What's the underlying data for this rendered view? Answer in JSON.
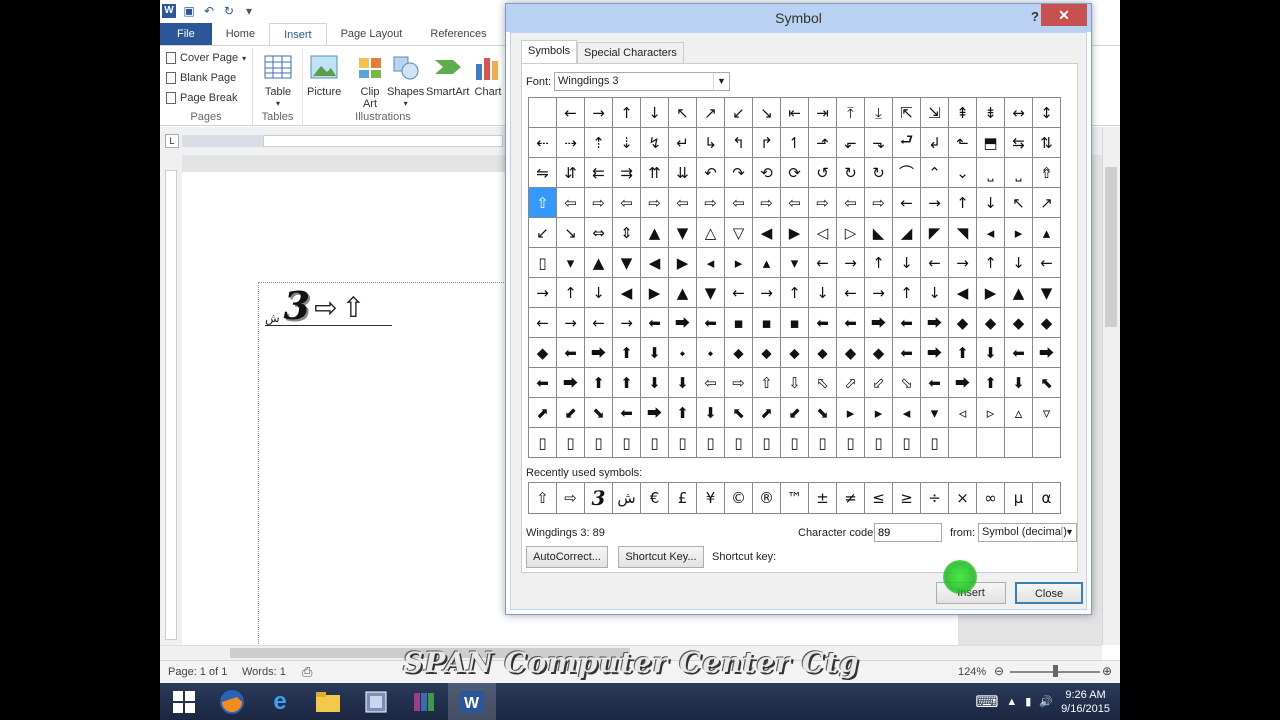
{
  "word": {
    "file_tab": "File",
    "tabs": [
      "Home",
      "Insert",
      "Page Layout",
      "References",
      "M"
    ],
    "pages_group": {
      "label": "Pages",
      "items": [
        "Cover Page",
        "Blank Page",
        "Page Break"
      ]
    },
    "tables_group": {
      "label": "Tables",
      "item": "Table"
    },
    "illustrations_group": {
      "label": "Illustrations",
      "items": [
        "Picture",
        "Clip Art",
        "Shapes",
        "SmartArt",
        "Chart"
      ]
    },
    "ruler_corner": "L",
    "status": {
      "page": "Page: 1 of 1",
      "words": "Words: 1",
      "zoom": "124%"
    },
    "doc_text_small": "ش"
  },
  "dialog": {
    "title": "Symbol",
    "help": "?",
    "close_x": "✕",
    "tabs": [
      "Symbols",
      "Special Characters"
    ],
    "font_label": "Font:",
    "font_value": "Wingdings 3",
    "grid": [
      [
        "",
        "←",
        "→",
        "↑",
        "↓",
        "↖",
        "↗",
        "↙",
        "↘",
        "⇤",
        "⇥",
        "⤒",
        "⤓",
        "⇱",
        "⇲",
        "⇞",
        "⇟",
        "↔",
        "↕"
      ],
      [
        "⇠",
        "⇢",
        "⇡",
        "⇣",
        "↯",
        "↵",
        "↳",
        "↰",
        "↱",
        "↿",
        "⬏",
        "⬐",
        "⬎",
        "⮐",
        "↲",
        "⬑",
        "⬒",
        "⇆",
        "⇅"
      ],
      [
        "⇋",
        "⇵",
        "⇇",
        "⇉",
        "⇈",
        "⇊",
        "↶",
        "↷",
        "⟲",
        "⟳",
        "↺",
        "↻",
        "↻",
        "⌒",
        "⌃",
        "⌄",
        "⎵",
        "⎵",
        "⇮"
      ],
      [
        "⇧",
        "⇦",
        "⇨",
        "⇦",
        "⇨",
        "⇦",
        "⇨",
        "⇦",
        "⇨",
        "⇦",
        "⇨",
        "⇦",
        "⇨",
        "←",
        "→",
        "↑",
        "↓",
        "↖",
        "↗"
      ],
      [
        "↙",
        "↘",
        "⇔",
        "⇕",
        "▲",
        "▼",
        "△",
        "▽",
        "◀",
        "▶",
        "◁",
        "▷",
        "◣",
        "◢",
        "◤",
        "◥",
        "◂",
        "▸",
        "▴"
      ],
      [
        "▯",
        "▾",
        "▲",
        "▼",
        "◀",
        "▶",
        "◂",
        "▸",
        "▴",
        "▾",
        "←",
        "→",
        "↑",
        "↓",
        "←",
        "→",
        "↑",
        "↓",
        "←"
      ],
      [
        "→",
        "↑",
        "↓",
        "◀",
        "▶",
        "▲",
        "▼",
        "←",
        "→",
        "↑",
        "↓",
        "←",
        "→",
        "↑",
        "↓",
        "◀",
        "▶",
        "▲",
        "▼"
      ],
      [
        "←",
        "→",
        "←",
        "→",
        "⬅",
        "⮕",
        "⬅",
        "▪",
        "▪",
        "▪",
        "⬅",
        "⬅",
        "⮕",
        "⬅",
        "⮕",
        "◆",
        "◆",
        "◆",
        "◆"
      ],
      [
        "◆",
        "⬅",
        "⮕",
        "⬆",
        "⬇",
        "⬩",
        "⬩",
        "⬥",
        "⬥",
        "⬥",
        "⬥",
        "◆",
        "◆",
        "⬅",
        "⮕",
        "⬆",
        "⬇",
        "⬅",
        "⮕"
      ],
      [
        "⬅",
        "⮕",
        "⬆",
        "⬆",
        "⬇",
        "⬇",
        "⇦",
        "⇨",
        "⇧",
        "⇩",
        "⬁",
        "⬀",
        "⬃",
        "⬂",
        "⬅",
        "⮕",
        "⬆",
        "⬇",
        "⬉"
      ],
      [
        "⬈",
        "⬋",
        "⬊",
        "⬅",
        "⮕",
        "⬆",
        "⬇",
        "⬉",
        "⬈",
        "⬋",
        "⬊",
        "▸",
        "▸",
        "◂",
        "▾",
        "◃",
        "▹",
        "▵",
        "▿"
      ],
      [
        "▯",
        "▯",
        "▯",
        "▯",
        "▯",
        "▯",
        "▯",
        "▯",
        "▯",
        "▯",
        "▯",
        "▯",
        "▯",
        "▯",
        "▯",
        "",
        "",
        "",
        ""
      ]
    ],
    "selected": {
      "row": 3,
      "col": 0
    },
    "recent_label": "Recently used symbols:",
    "recent": [
      "⇧",
      "⇨",
      "3",
      "ش",
      "€",
      "£",
      "¥",
      "©",
      "®",
      "™",
      "±",
      "≠",
      "≤",
      "≥",
      "÷",
      "×",
      "∞",
      "µ",
      "α"
    ],
    "char_name": "Wingdings 3: 89",
    "code_label": "Character code:",
    "code_value": "89",
    "from_label": "from:",
    "from_value": "Symbol (decimal)",
    "autocorrect": "AutoCorrect...",
    "shortcut_key_btn": "Shortcut Key...",
    "shortcut_key_label": "Shortcut key:",
    "insert": "Insert",
    "close": "Close"
  },
  "taskbar": {
    "time": "9:26 AM",
    "date": "9/16/2015"
  },
  "watermark": "SPAN Computer Center Ctg"
}
